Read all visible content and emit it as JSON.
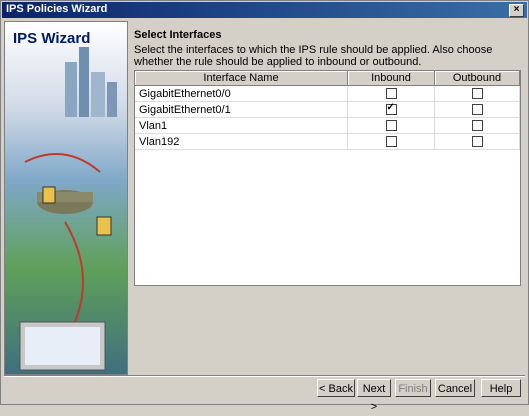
{
  "window": {
    "title": "IPS Policies Wizard",
    "close": "×"
  },
  "left_panel": {
    "title": "IPS Wizard"
  },
  "content": {
    "section_title": "Select Interfaces",
    "description": "Select the interfaces to which the IPS rule should be applied. Also choose whether the rule should be applied to inbound or outbound."
  },
  "table": {
    "columns": [
      "Interface Name",
      "Inbound",
      "Outbound"
    ],
    "rows": [
      {
        "name": "GigabitEthernet0/0",
        "inbound": false,
        "outbound": false
      },
      {
        "name": "GigabitEthernet0/1",
        "inbound": true,
        "outbound": false
      },
      {
        "name": "Vlan1",
        "inbound": false,
        "outbound": false
      },
      {
        "name": "Vlan192",
        "inbound": false,
        "outbound": false
      }
    ]
  },
  "buttons": {
    "back": "< Back",
    "next": "Next >",
    "finish": "Finish",
    "cancel": "Cancel",
    "help": "Help"
  }
}
